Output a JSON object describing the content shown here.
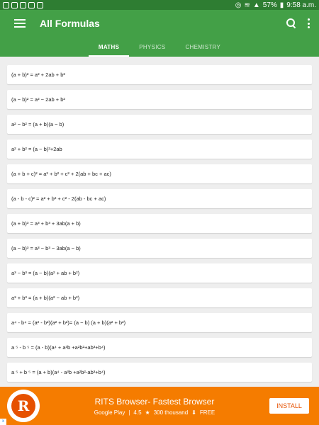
{
  "status_bar": {
    "battery": "57%",
    "time": "9:58 a.m."
  },
  "app_bar": {
    "title": "All Formulas",
    "tabs": [
      {
        "label": "MATHS",
        "active": true
      },
      {
        "label": "PHYSICS",
        "active": false
      },
      {
        "label": "CHEMISTRY",
        "active": false
      }
    ]
  },
  "formulas": [
    "(a + b)² = a² + 2ab + b²",
    "(a − b)² = a² − 2ab + b²",
    "a² − b² = (a + b)(a − b)",
    "a² + b² = (a − b)²+2ab",
    "(a + b + c)² = a² + b² + c² + 2(ab + bc + ac)",
    "(a - b - c)² = a² + b² + c² - 2(ab - bc + ac)",
    "(a + b)³ = a³ + b³ + 3ab(a + b)",
    "(a − b)³ = a³ − b³ − 3ab(a − b)",
    "a³ − b³ = (a − b)(a² + ab + b²)",
    "a³ + b³ = (a + b)(a² − ab + b²)",
    "a⁴ - b⁴ = (a² - b²)(a² + b²)= (a − b) (a + b)(a² + b²)",
    "a ⁵ - b ⁵ = (a - b)(a⁴ + a³b +a²b²+ab³+b⁴)",
    "a ⁵ + b ⁵ = (a + b)(a⁴ - a³b +a²b²-ab³+b⁴)"
  ],
  "ad": {
    "logo_letter": "R",
    "title": "RITS Browser- Fastest Browser",
    "store": "Google Play",
    "rating": "4.5",
    "downloads": "300 thousand",
    "price": "FREE",
    "install_label": "INSTALL",
    "close_label": "x"
  },
  "colors": {
    "status_bar": "#2e7d32",
    "app_bar": "#43a047",
    "ad_background": "#f57c00"
  }
}
